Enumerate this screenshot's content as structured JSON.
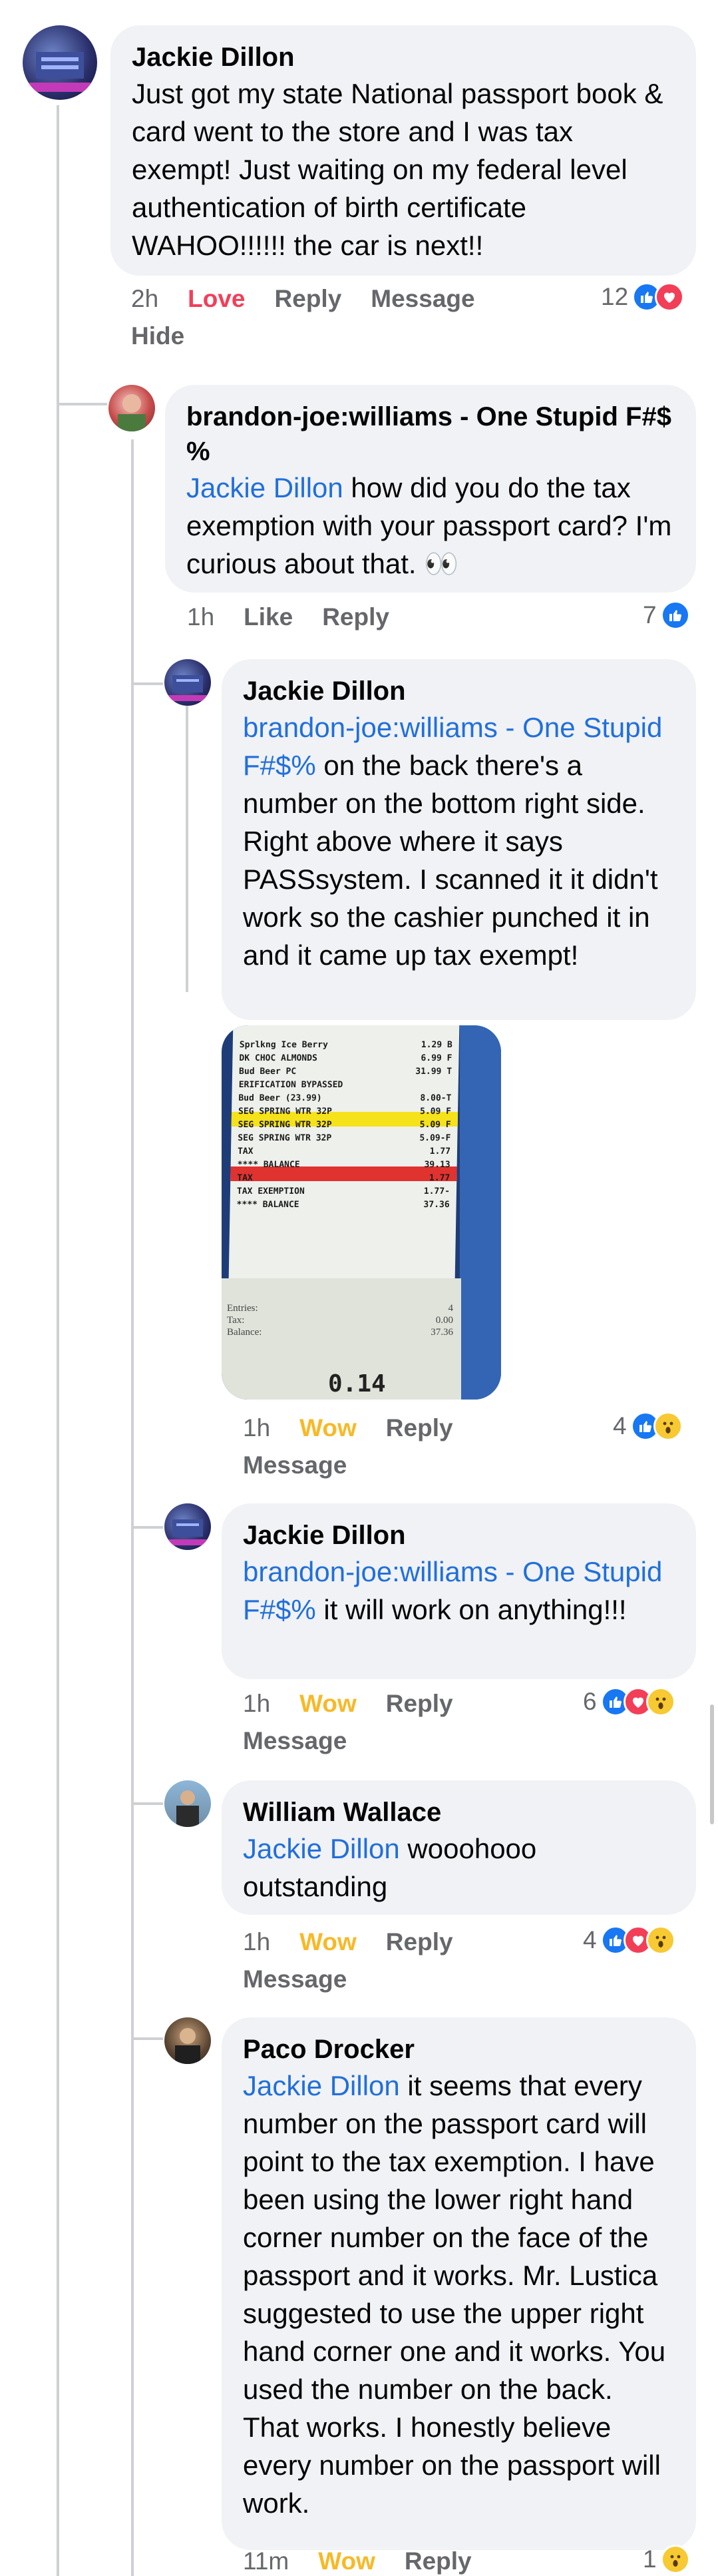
{
  "comments": [
    {
      "author": "Jackie Dillon",
      "text": "Just got my state National passport book & card went to the store and I was tax exempt! Just waiting on my federal level authentication of birth certificate WAHOO!!!!!! the car is next!!",
      "time": "2h",
      "reaction_label": "Love",
      "reply_label": "Reply",
      "message_label": "Message",
      "hide_label": "Hide",
      "reaction_count": "12"
    },
    {
      "author": "brandon-joe:williams - One Stupid F#$ %",
      "mention": "Jackie Dillon",
      "text": " how did you do the tax exemption with your passport card? I'm curious about that. 👀",
      "time": "1h",
      "reaction_label": "Like",
      "reply_label": "Reply",
      "reaction_count": "7"
    },
    {
      "author": "Jackie Dillon",
      "mention": "brandon-joe:williams - One Stupid F#$%",
      "text": " on the back there's a number on the bottom right side. Right above where it says PASSsystem. I scanned it it didn't work so the cashier punched it in and it came up tax exempt!",
      "time": "1h",
      "reaction_label": "Wow",
      "reply_label": "Reply",
      "message_label": "Message",
      "reaction_count": "4"
    },
    {
      "author": "Jackie Dillon",
      "mention": "brandon-joe:williams - One Stupid F#$%",
      "text": " it will work on anything!!!",
      "time": "1h",
      "reaction_label": "Wow",
      "reply_label": "Reply",
      "message_label": "Message",
      "reaction_count": "6"
    },
    {
      "author": "William Wallace",
      "mention": "Jackie Dillon",
      "text": " wooohooo outstanding",
      "time": "1h",
      "reaction_label": "Wow",
      "reply_label": "Reply",
      "message_label": "Message",
      "reaction_count": "4"
    },
    {
      "author": "Paco Drocker",
      "mention": "Jackie Dillon",
      "text": " it seems that every number on the passport card will point to the tax exemption. I have been using the lower right hand corner number on the face of the passport and it works. Mr. Lustica suggested to use the upper right hand corner one and it works. You used the number on the back. That works. I honestly believe every number on the passport will work.",
      "time": "11m",
      "reaction_label": "Wow",
      "reply_label": "Reply",
      "reaction_count": "1"
    }
  ],
  "receipt": {
    "lines": [
      [
        "Sprlkng Ice Berry",
        "1.29 B"
      ],
      [
        "DK CHOC ALMONDS",
        "6.99 F"
      ],
      [
        "Bud Beer       PC",
        "31.99 T"
      ],
      [
        "ERIFICATION BYPASSED",
        ""
      ],
      [
        "Bud Beer   (23.99)",
        "8.00-T"
      ],
      [
        "SEG SPRING WTR 32P",
        "5.09 F"
      ],
      [
        "SEG SPRING WTR 32P",
        "5.09 F"
      ],
      [
        "SEG SPRING WTR 32P",
        "5.09-F"
      ],
      [
        "TAX",
        "1.77"
      ],
      [
        "**** BALANCE",
        "39.13"
      ],
      [
        "TAX",
        "1.77"
      ],
      [
        "TAX EXEMPTION",
        "1.77-"
      ],
      [
        "**** BALANCE",
        "37.36"
      ]
    ],
    "summary": [
      [
        "Entries:",
        "4"
      ],
      [
        "Tax:",
        "0.00"
      ],
      [
        "Balance:",
        "37.36"
      ]
    ],
    "display_value": "0.14"
  },
  "colors": {
    "bubble": "#f0f2f5",
    "mention": "#216fdb",
    "love": "#f33e58",
    "wow": "#f7b928",
    "like": "#1877f2",
    "meta": "#65676b"
  }
}
